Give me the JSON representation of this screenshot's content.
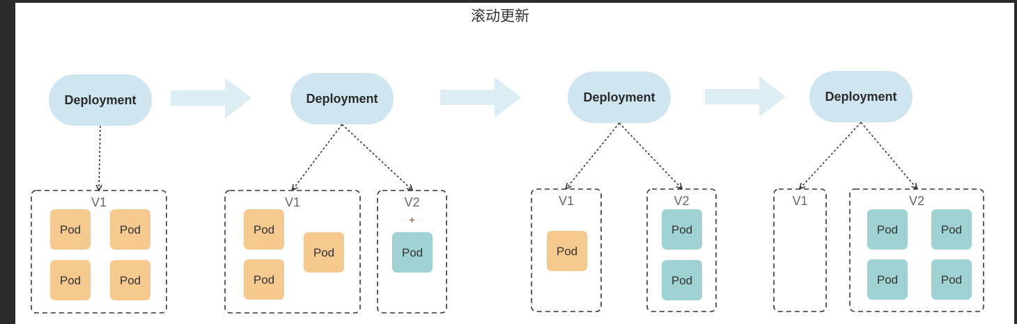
{
  "title": "滚动更新",
  "colors": {
    "deployment_fill": "#cfe5ef",
    "arrow_fill": "#dcedf3",
    "pod_v1": "#f6c98f",
    "pod_v2": "#9fd3d3",
    "dashed_stroke": "#333333",
    "new_pod_marker": "#d11a1a"
  },
  "stages": [
    {
      "deployment_label": "Deployment",
      "groups": [
        {
          "label": "V1",
          "version": "v1",
          "pods": [
            "Pod",
            "Pod",
            "Pod",
            "Pod"
          ]
        }
      ]
    },
    {
      "deployment_label": "Deployment",
      "groups": [
        {
          "label": "V1",
          "version": "v1",
          "pods": [
            "Pod",
            "Pod",
            "Pod"
          ]
        },
        {
          "label": "V2",
          "version": "v2",
          "pods": [
            "Pod"
          ],
          "marker": "+"
        }
      ]
    },
    {
      "deployment_label": "Deployment",
      "groups": [
        {
          "label": "V1",
          "version": "v1",
          "pods": [
            "Pod"
          ]
        },
        {
          "label": "V2",
          "version": "v2",
          "pods": [
            "Pod",
            "Pod"
          ]
        }
      ]
    },
    {
      "deployment_label": "Deployment",
      "groups": [
        {
          "label": "V1",
          "version": "v1",
          "pods": []
        },
        {
          "label": "V2",
          "version": "v2",
          "pods": [
            "Pod",
            "Pod",
            "Pod",
            "Pod"
          ]
        }
      ]
    }
  ]
}
